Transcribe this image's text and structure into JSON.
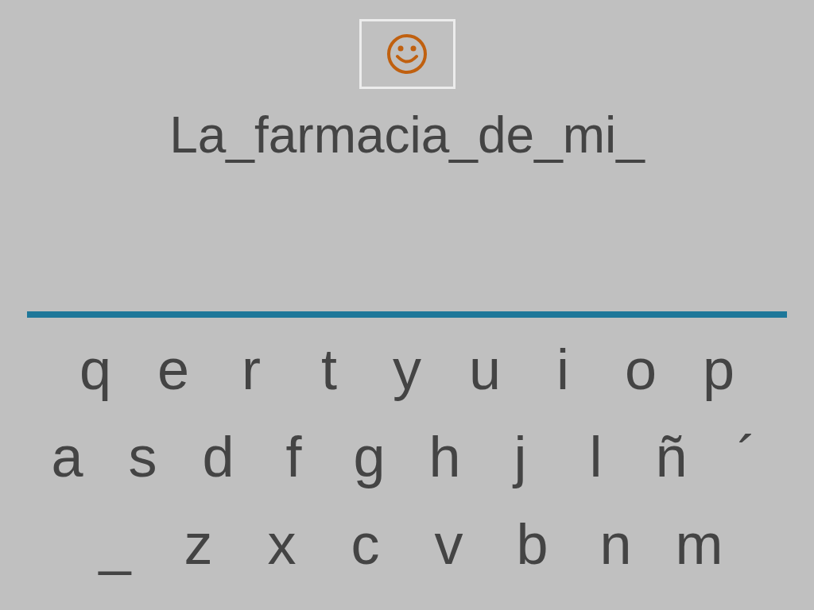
{
  "phrase": "La_farmacia_de_mi_",
  "keyboard_rows": [
    [
      "q",
      "e",
      "r",
      "t",
      "y",
      "u",
      "i",
      "o",
      "p"
    ],
    [
      "a",
      "s",
      "d",
      "f",
      "g",
      "h",
      "j",
      "l",
      "ñ",
      "´"
    ],
    [
      "_",
      "z",
      "x",
      "c",
      "v",
      "b",
      "n",
      "m"
    ]
  ]
}
